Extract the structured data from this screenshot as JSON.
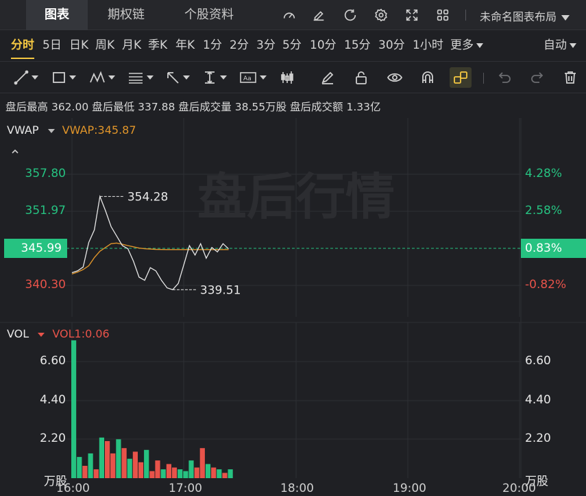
{
  "tabs": [
    "图表",
    "期权链",
    "个股资料"
  ],
  "layout_name": "未命名图表布局",
  "icons": [
    "speedometer-icon",
    "edit-icon",
    "refresh-icon",
    "gear-icon",
    "fullscreen-icon",
    "grid-icon",
    "chevron-down-icon"
  ],
  "periods": [
    "分时",
    "5日",
    "日K",
    "周K",
    "月K",
    "季K",
    "年K",
    "1分",
    "2分",
    "3分",
    "5分",
    "10分",
    "15分",
    "30分",
    "1小时",
    "更多"
  ],
  "active_period": "分时",
  "adjust": "自动",
  "info": {
    "high_label": "盘后最高",
    "high": "362.00",
    "low_label": "盘后最低",
    "low": "337.88",
    "vol_label": "盘后成交量",
    "vol": "38.55万股",
    "amt_label": "盘后成交额",
    "amt": "1.33亿"
  },
  "watermark": "盘后行情",
  "price_panel": {
    "indicator": "VWAP",
    "indicator_value": "VWAP:345.87",
    "y_left": [
      "357.80",
      "351.97",
      "345.99",
      "340.30"
    ],
    "y_right": [
      "4.28%",
      "2.58%",
      "0.83%",
      "-0.82%"
    ],
    "current": "345.99",
    "current_pct": "0.83%",
    "high_mark": "354.28",
    "low_mark": "339.51",
    "colors": {
      "up": "#26c281",
      "down": "#e8534a",
      "vwap": "#e0952a",
      "price": "#e8e8e8"
    }
  },
  "vol_panel": {
    "indicator": "VOL",
    "indicator_value": "VOL1:0.06",
    "y_left": [
      "6.60",
      "4.40",
      "2.20",
      "万股"
    ],
    "y_right": [
      "6.60",
      "4.40",
      "2.20",
      "万股"
    ]
  },
  "x_labels": [
    "16:00",
    "17:00",
    "18:00",
    "19:00",
    "20:00"
  ],
  "chart_data": {
    "type": "line",
    "x_range": [
      "16:00",
      "20:00"
    ],
    "price_range": [
      337.5,
      362
    ],
    "price": [
      342.2,
      342.5,
      343.1,
      347.0,
      349.0,
      354.28,
      352.0,
      349.5,
      348.0,
      346.5,
      346.0,
      344.0,
      341.5,
      341.0,
      343.0,
      342.5,
      341.0,
      339.8,
      339.51,
      340.5,
      343.5,
      346.5,
      345.0,
      346.8,
      344.5,
      346.2,
      345.5,
      346.8,
      345.99
    ],
    "vwap": [
      342.0,
      342.3,
      342.7,
      343.3,
      344.6,
      345.6,
      346.2,
      346.8,
      346.9,
      346.7,
      346.5,
      346.3,
      346.1,
      346.0,
      345.95,
      345.9,
      345.88,
      345.87,
      345.87,
      345.87,
      345.87,
      345.88,
      345.87,
      345.87,
      345.87,
      345.87,
      345.87,
      345.87,
      345.87
    ],
    "volume": [
      7.8,
      1.2,
      0.7,
      1.4,
      0.5,
      2.3,
      2.1,
      1.4,
      2.2,
      1.7,
      1.1,
      1.5,
      0.9,
      1.6,
      0.4,
      1.0,
      0.5,
      0.8,
      0.6,
      0.5,
      0.4,
      1.0,
      0.6,
      1.7,
      0.8,
      0.6,
      0.5,
      0.3,
      0.5
    ],
    "vol_up": [
      1,
      1,
      0,
      1,
      0,
      1,
      0,
      0,
      1,
      0,
      1,
      0,
      0,
      1,
      0,
      0,
      1,
      0,
      0,
      1,
      1,
      1,
      0,
      0,
      1,
      0,
      1,
      0,
      1
    ],
    "volume_ylim": [
      0,
      7.8
    ]
  }
}
